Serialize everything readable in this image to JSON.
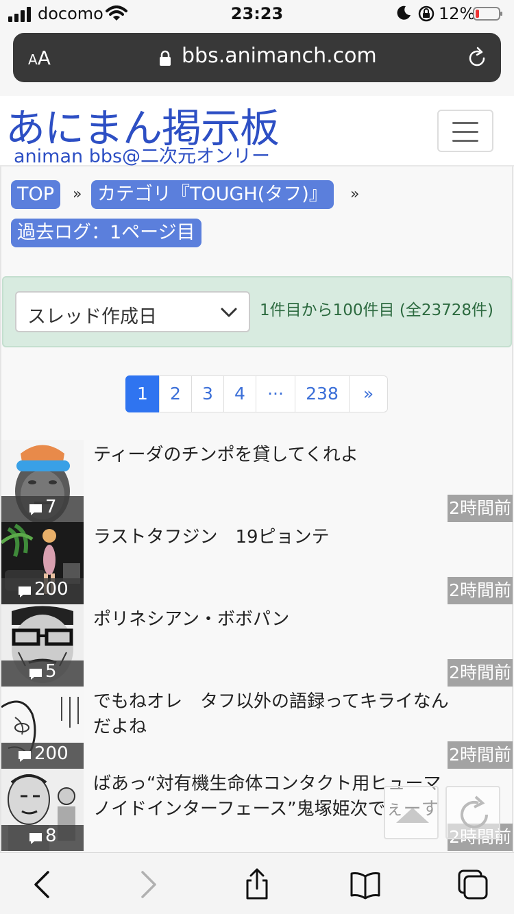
{
  "status_bar": {
    "carrier": "docomo",
    "time": "23:23",
    "battery": "12%",
    "icons": [
      "signal-icon",
      "wifi-icon",
      "moon-icon",
      "orientation-lock-icon",
      "battery-low-icon"
    ]
  },
  "browser": {
    "text_size_label_small": "A",
    "text_size_label_large": "A",
    "url": "bbs.animanch.com",
    "icons": [
      "lock-icon",
      "reload-icon"
    ]
  },
  "header": {
    "title": "あにまん掲示板",
    "subtitle": "animan bbs@二次元オンリー",
    "menu_icon": "hamburger-icon",
    "brand_color": "#2d4fc4"
  },
  "breadcrumb": {
    "items": [
      {
        "label": "TOP"
      },
      {
        "label": "カテゴリ『TOUGH(タフ)』"
      },
      {
        "label": "過去ログ：1ページ目"
      }
    ],
    "separator": "»",
    "color": "#5b7fdc"
  },
  "filter": {
    "sort_selected": "スレッド作成日",
    "count_text": "1件目から100件目 (全23728件)"
  },
  "pagination": {
    "pages": [
      "1",
      "2",
      "3",
      "4",
      "···",
      "238",
      "»"
    ],
    "current": "1",
    "accent": "#2f74f0"
  },
  "threads": [
    {
      "title": "ティーダのチンポを貸してくれよ",
      "replies": "7",
      "time": "2時間前"
    },
    {
      "title": "ラストタフジン　19ピョンテ",
      "replies": "200",
      "time": "2時間前"
    },
    {
      "title": "ポリネシアン・ボボパン",
      "replies": "5",
      "time": "2時間前"
    },
    {
      "title": "でもねオレ　タフ以外の語録ってキライなんだよね",
      "replies": "200",
      "time": "2時間前"
    },
    {
      "title": "ばあっ“対有機生命体コンタクト用ヒューマノイドインターフェース”鬼塚姫次でぇーす",
      "replies": "8",
      "time": "2時間前"
    }
  ],
  "floating": {
    "icons": [
      "scroll-top-icon",
      "refresh-icon"
    ]
  },
  "toolbar": {
    "icons": [
      "back-icon",
      "forward-icon",
      "share-icon",
      "bookmarks-icon",
      "tabs-icon"
    ]
  }
}
